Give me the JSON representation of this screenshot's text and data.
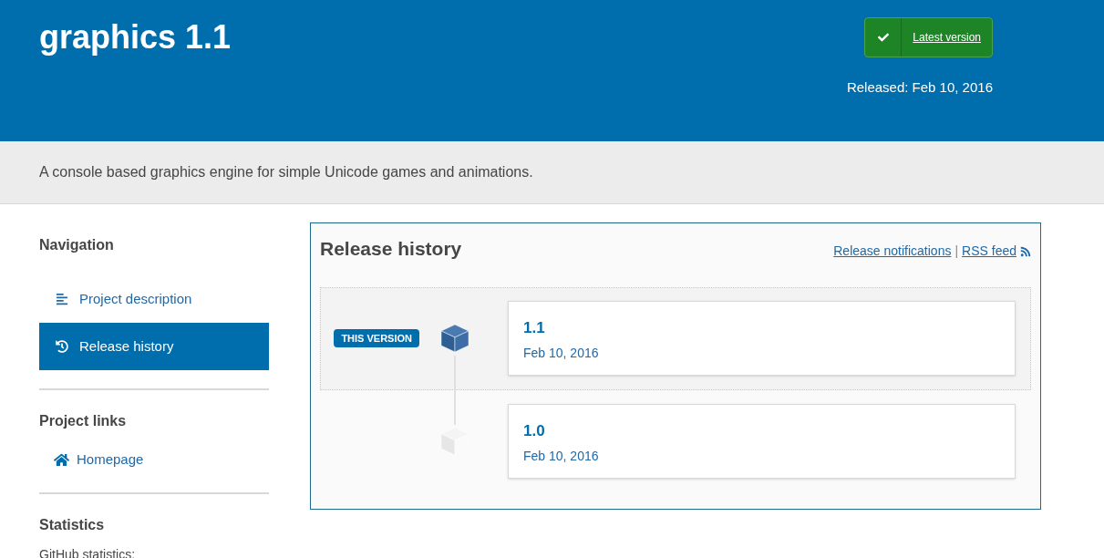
{
  "header": {
    "title": "graphics 1.1",
    "latest_button": "Latest version",
    "released": "Released: Feb 10, 2016"
  },
  "summary": "A console based graphics engine for simple Unicode games and animations.",
  "sidebar": {
    "navigation": {
      "heading": "Navigation",
      "items": [
        {
          "label": "Project description",
          "selected": false
        },
        {
          "label": "Release history",
          "selected": true
        }
      ]
    },
    "project_links": {
      "heading": "Project links",
      "items": [
        {
          "label": "Homepage"
        }
      ]
    },
    "statistics": {
      "heading": "Statistics",
      "text": "GitHub statistics:"
    }
  },
  "release_history": {
    "title": "Release history",
    "notifications_link": "Release notifications",
    "separator": "|",
    "rss_link": "RSS feed",
    "releases": [
      {
        "version": "1.1",
        "date": "Feb 10, 2016",
        "selected": true,
        "badge": "THIS VERSION"
      },
      {
        "version": "1.0",
        "date": "Feb 10, 2016",
        "selected": false
      }
    ]
  }
}
